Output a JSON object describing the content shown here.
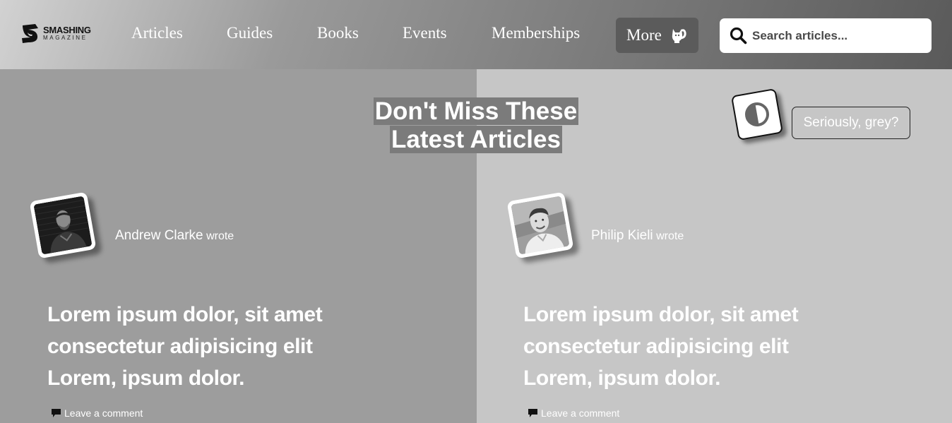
{
  "header": {
    "logo": {
      "top": "SMASHING",
      "bottom": "MAGAZINE"
    },
    "nav": [
      {
        "label": "Articles"
      },
      {
        "label": "Guides"
      },
      {
        "label": "Books"
      },
      {
        "label": "Events"
      },
      {
        "label": "Memberships"
      }
    ],
    "more_label": "More",
    "search": {
      "placeholder": "Search articles...",
      "value": ""
    }
  },
  "main": {
    "section_title": "Don't Miss These Latest Articles",
    "contrast_toggle_icon": "contrast-icon",
    "grey_button_label": "Seriously, grey?",
    "articles": [
      {
        "author": "Andrew Clarke",
        "wrote": "wrote",
        "title": "Lorem ipsum dolor, sit amet consectetur adipisicing elit Lorem, ipsum dolor.",
        "comment_label": "Leave a comment"
      },
      {
        "author": "Philip Kieli",
        "wrote": "wrote",
        "title": "Lorem ipsum dolor, sit amet consectetur adipisicing elit Lorem, ipsum dolor.",
        "comment_label": "Leave a comment"
      }
    ]
  },
  "colors": {
    "left_panel": "#9d9d9d",
    "right_panel": "#c6c6c6",
    "title_highlight": "#7b7b7b",
    "more_button": "#5b5b5b"
  }
}
